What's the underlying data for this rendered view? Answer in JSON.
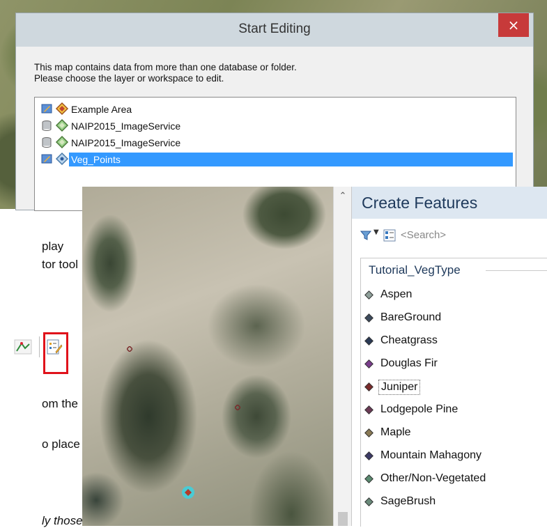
{
  "dialog": {
    "title": "Start Editing",
    "close_label": "×",
    "message_line1": "This map contains data from more than one database or folder.",
    "message_line2": "Please choose the layer or workspace to edit.",
    "layers": [
      {
        "label": "Example Area",
        "type": "editable-folder",
        "selected": false
      },
      {
        "label": "NAIP2015_ImageService",
        "type": "database",
        "selected": false
      },
      {
        "label": "NAIP2015_ImageService",
        "type": "database",
        "selected": false
      },
      {
        "label": "Veg_Points",
        "type": "editable-folder",
        "selected": true
      }
    ]
  },
  "side_text": {
    "line1": "play",
    "line2": "tor tool",
    "line3": "om the",
    "line4": "o place",
    "line5": "ly those"
  },
  "create_features": {
    "title": "Create Features",
    "search_placeholder": "<Search>",
    "group_heading": "Tutorial_VegType",
    "templates": [
      {
        "label": "Aspen",
        "color": "#8fa09a"
      },
      {
        "label": "BareGround",
        "color": "#3c4a5c"
      },
      {
        "label": "Cheatgrass",
        "color": "#2a3a55"
      },
      {
        "label": "Douglas Fir",
        "color": "#7a3d8c"
      },
      {
        "label": "Juniper",
        "color": "#7a2a2a"
      },
      {
        "label": "Lodgepole Pine",
        "color": "#6b3a55"
      },
      {
        "label": "Maple",
        "color": "#8a7a55"
      },
      {
        "label": "Mountain Mahagony",
        "color": "#3c3a66"
      },
      {
        "label": "Other/Non-Vegetated",
        "color": "#5a8a70"
      },
      {
        "label": "SageBrush",
        "color": "#6a8a7a"
      }
    ],
    "focused_template": "Juniper"
  },
  "colors": {
    "selection": "#3399ff",
    "highlight_box": "#e0121b",
    "panel_title": "#1e395b",
    "close_button": "#c73a3a"
  }
}
